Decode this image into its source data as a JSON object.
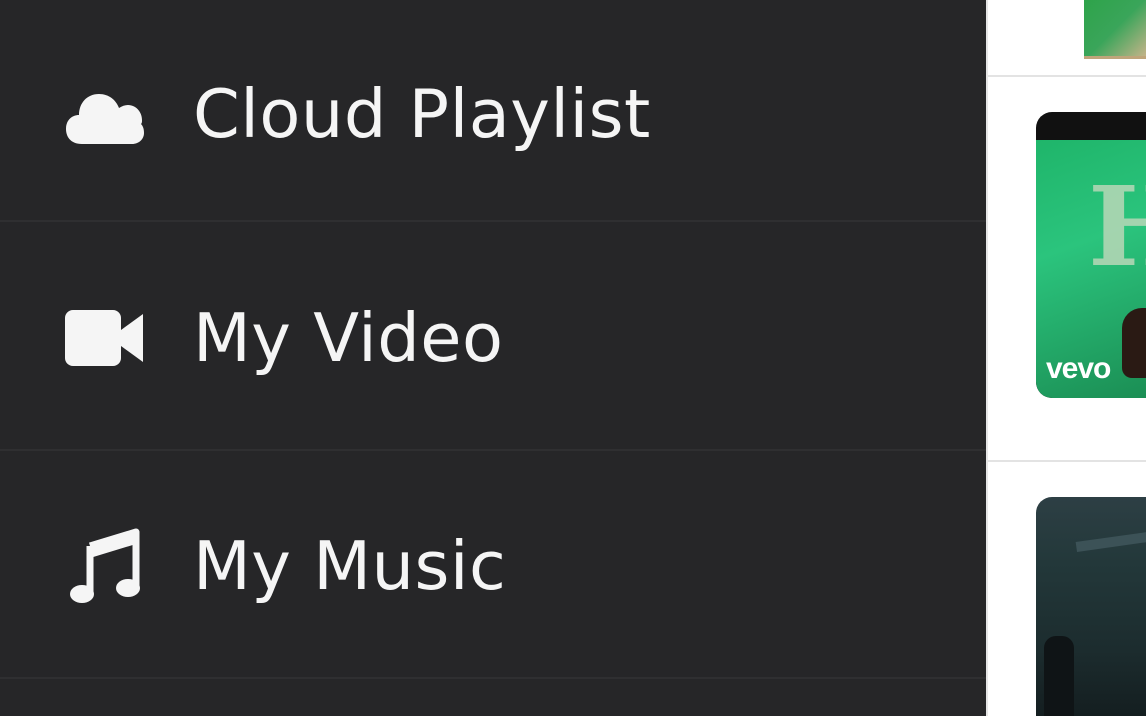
{
  "menu": {
    "items": [
      {
        "label": "Cloud Playlist",
        "icon": "cloud-icon"
      },
      {
        "label": "My Video",
        "icon": "video-camera-icon"
      },
      {
        "label": "My Music",
        "icon": "music-note-icon"
      }
    ]
  },
  "video_list": {
    "items": [
      {
        "badge": ""
      },
      {
        "badge": "vevo"
      },
      {
        "badge": ""
      }
    ]
  },
  "colors": {
    "drawer_bg": "#262628",
    "text": "#f5f5f5",
    "divider": "#2f2f31"
  }
}
